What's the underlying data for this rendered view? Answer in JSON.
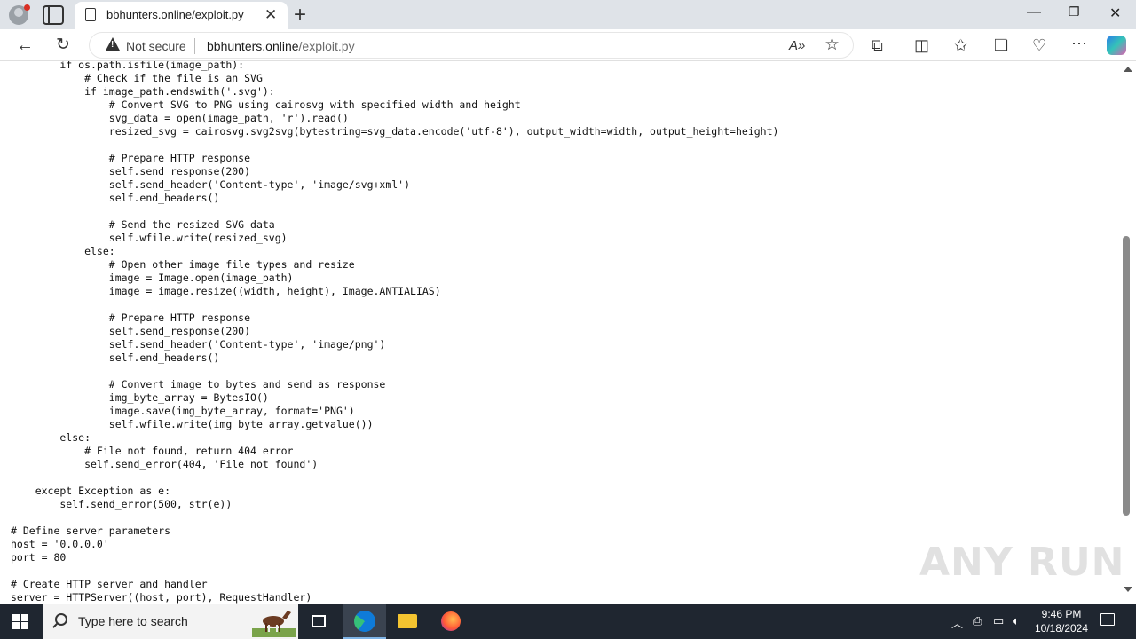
{
  "browser": {
    "tab_title": "bbhunters.online/exploit.py",
    "security_label": "Not secure",
    "url_host": "bbhunters.online",
    "url_path": "/exploit.py"
  },
  "code_lines": [
    "        if os.path.isfile(image_path):",
    "            # Check if the file is an SVG",
    "            if image_path.endswith('.svg'):",
    "                # Convert SVG to PNG using cairosvg with specified width and height",
    "                svg_data = open(image_path, 'r').read()",
    "                resized_svg = cairosvg.svg2svg(bytestring=svg_data.encode('utf-8'), output_width=width, output_height=height)",
    "",
    "                # Prepare HTTP response",
    "                self.send_response(200)",
    "                self.send_header('Content-type', 'image/svg+xml')",
    "                self.end_headers()",
    "",
    "                # Send the resized SVG data",
    "                self.wfile.write(resized_svg)",
    "            else:",
    "                # Open other image file types and resize",
    "                image = Image.open(image_path)",
    "                image = image.resize((width, height), Image.ANTIALIAS)",
    "",
    "                # Prepare HTTP response",
    "                self.send_response(200)",
    "                self.send_header('Content-type', 'image/png')",
    "                self.end_headers()",
    "",
    "                # Convert image to bytes and send as response",
    "                img_byte_array = BytesIO()",
    "                image.save(img_byte_array, format='PNG')",
    "                self.wfile.write(img_byte_array.getvalue())",
    "        else:",
    "            # File not found, return 404 error",
    "            self.send_error(404, 'File not found')",
    "",
    "    except Exception as e:",
    "        self.send_error(500, str(e))",
    "",
    "# Define server parameters",
    "host = '0.0.0.0'",
    "port = 80",
    "",
    "# Create HTTP server and handler",
    "server = HTTPServer((host, port), RequestHandler)"
  ],
  "watermark": "ANY RUN",
  "taskbar": {
    "search_placeholder": "Type here to search",
    "time": "9:46 PM",
    "date": "10/18/2024"
  },
  "colors": {
    "taskbar_bg": "#1f2630",
    "edge_blue": "#0f7bd8",
    "tabstrip_bg": "#dfe3e8"
  }
}
